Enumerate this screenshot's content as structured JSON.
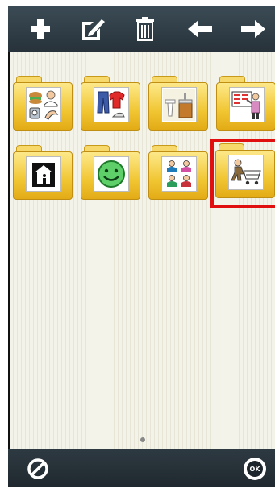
{
  "toolbar": {
    "icons": [
      "plus-icon",
      "edit-icon",
      "trash-icon",
      "arrow-left-icon",
      "arrow-right-icon"
    ]
  },
  "folders": [
    {
      "name": "food-health",
      "icon": "food-doctor-picture"
    },
    {
      "name": "clothes",
      "icon": "clothes-picture"
    },
    {
      "name": "bathroom",
      "icon": "bathroom-picture"
    },
    {
      "name": "school",
      "icon": "teacher-board-picture"
    },
    {
      "name": "home",
      "icon": "house-picture"
    },
    {
      "name": "feelings",
      "icon": "smiley-picture"
    },
    {
      "name": "people",
      "icon": "people-picture"
    },
    {
      "name": "shopping",
      "icon": "shopping-cart-picture"
    }
  ],
  "selected_folder": "shopping",
  "pagination": {
    "current": 1,
    "total": 1
  },
  "bottom": {
    "cancel_icon": "cancel-icon",
    "ok_label": "OK"
  },
  "colors": {
    "selection": "#e01010",
    "folder": "#f1c633",
    "toolbar": "#2f3b43"
  }
}
